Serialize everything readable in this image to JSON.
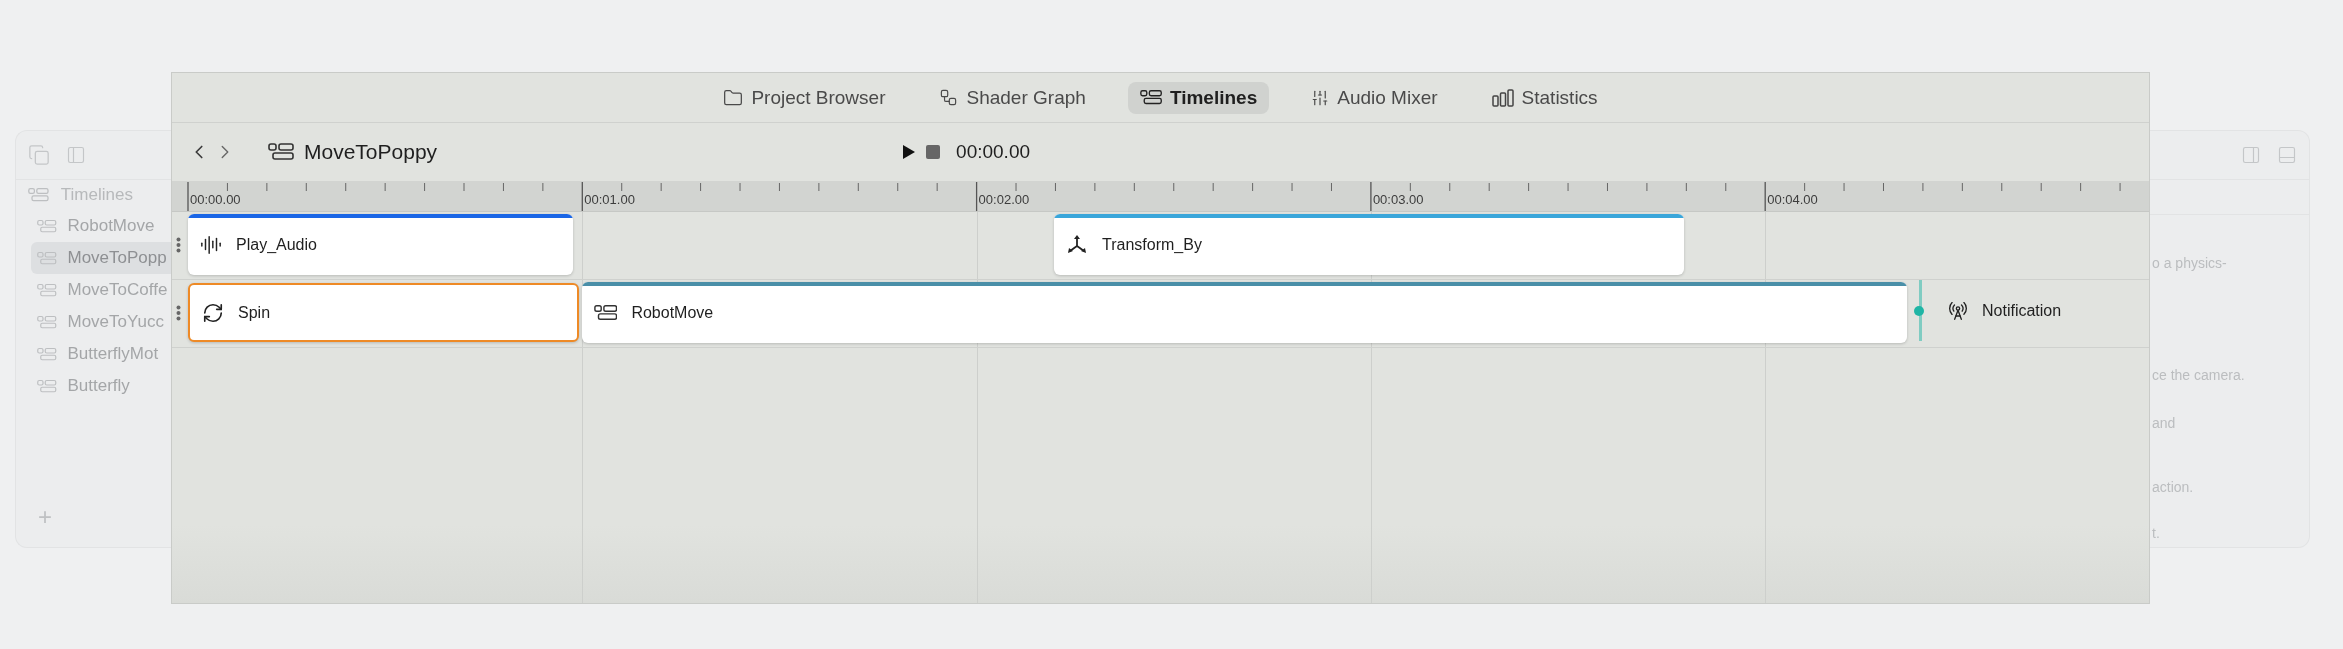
{
  "left_panel": {
    "title": "Timelines",
    "items": [
      {
        "label": "RobotMove",
        "selected": false
      },
      {
        "label": "MoveToPopp",
        "selected": true
      },
      {
        "label": "MoveToCoffe",
        "selected": false
      },
      {
        "label": "MoveToYucc",
        "selected": false
      },
      {
        "label": "ButterflyMot",
        "selected": false
      },
      {
        "label": "Butterfly",
        "selected": false
      }
    ],
    "add_symbol": "+"
  },
  "tabs": [
    {
      "kind": "folder",
      "label": "Project Browser",
      "selected": false
    },
    {
      "kind": "graph",
      "label": "Shader Graph",
      "selected": false
    },
    {
      "kind": "timeline",
      "label": "Timelines",
      "selected": true
    },
    {
      "kind": "mixer",
      "label": "Audio Mixer",
      "selected": false
    },
    {
      "kind": "stats",
      "label": "Statistics",
      "selected": false
    }
  ],
  "header": {
    "title": "MoveToPoppy",
    "time": "00:00.00"
  },
  "ruler": {
    "labels": [
      "00:00.00",
      "00:01.00",
      "00:02.00",
      "00:03.00",
      "00:04.00"
    ]
  },
  "tracks": [
    {
      "clips": [
        {
          "kind": "audio",
          "label": "Play_Audio",
          "color": "#1a66e6",
          "selected": false
        },
        {
          "kind": "transform",
          "label": "Transform_By",
          "color": "#3aa6da",
          "selected": false
        }
      ]
    },
    {
      "clips": [
        {
          "kind": "spin",
          "label": "Spin",
          "selected": true
        },
        {
          "kind": "timeline",
          "label": "RobotMove",
          "color": "#4a8fa8",
          "selected": false
        },
        {
          "kind": "notification",
          "label": "Notification",
          "color": "#1fb5a5"
        }
      ]
    }
  ],
  "right_panel": {
    "lines": [
      "o a physics-",
      "ce the camera.",
      "and",
      "action.",
      "t."
    ]
  }
}
